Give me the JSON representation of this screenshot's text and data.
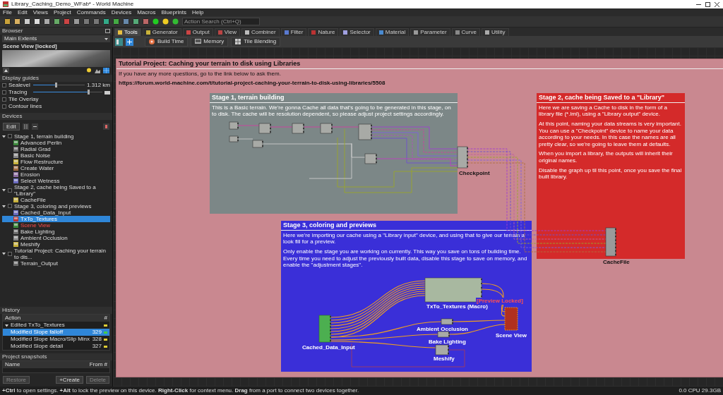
{
  "window": {
    "title": "Library_Caching_Demo_WFab* - World Machine"
  },
  "menu": [
    "File",
    "Edit",
    "Views",
    "Project",
    "Commands",
    "Devices",
    "Macros",
    "Blueprints",
    "Help"
  ],
  "action_search": {
    "placeholder": "Action Search (Ctrl+Q)"
  },
  "browser": {
    "title": "Browser",
    "view": "Main Extents",
    "preview_title": "Scene View [locked]"
  },
  "display_guides": {
    "title": "Display guides",
    "rows": [
      {
        "kind": "slider",
        "label": "Sealevel",
        "checked": false,
        "level": 0.45,
        "reading": "1.312 km"
      },
      {
        "kind": "slider",
        "label": "Tracing",
        "checked": false,
        "level": 0.8
      },
      {
        "kind": "check",
        "label": "Tile Overlay",
        "checked": false
      },
      {
        "kind": "check",
        "label": "Contour lines",
        "checked": false
      }
    ]
  },
  "devices": {
    "title": "Devices",
    "edit_button": "Edit",
    "tree": [
      {
        "label": "Stage 1, terrain building",
        "checked": false,
        "expanded": true,
        "children": [
          {
            "label": "Advanced Perlin",
            "selected": false,
            "preview": false
          },
          {
            "label": "Radial Grad",
            "selected": false,
            "preview": false
          },
          {
            "label": "Basic Noise",
            "selected": false,
            "preview": false
          },
          {
            "label": "Flow Restructure",
            "selected": false,
            "preview": false
          },
          {
            "label": "Create Water",
            "selected": false,
            "preview": false
          },
          {
            "label": "Erosion",
            "selected": false,
            "preview": false
          },
          {
            "label": "Select Wetness",
            "selected": false,
            "preview": false
          }
        ]
      },
      {
        "label": "Stage 2, cache being Saved to a \"Library\"",
        "checked": false,
        "expanded": true,
        "children": [
          {
            "label": "CacheFile",
            "selected": false,
            "preview": false
          }
        ]
      },
      {
        "label": "Stage 3, coloring and previews",
        "checked": false,
        "expanded": true,
        "children": [
          {
            "label": "Cached_Data_Input",
            "selected": false,
            "preview": false
          },
          {
            "label": "TxTo_Textures",
            "selected": true,
            "preview": false
          },
          {
            "label": "Scene View",
            "selected": false,
            "preview": true
          },
          {
            "label": "Bake Lighting",
            "selected": false,
            "preview": false
          },
          {
            "label": "Ambient Occlusion",
            "selected": false,
            "preview": false
          },
          {
            "label": "Meshify",
            "selected": false,
            "preview": false
          }
        ]
      },
      {
        "label": "Tutorial Project: Caching your terrain to dis...",
        "checked": false,
        "expanded": true,
        "children": [
          {
            "label": "Terrain_Output",
            "selected": false,
            "preview": false
          }
        ]
      }
    ]
  },
  "history": {
    "title": "History",
    "columns": [
      "Action",
      "#"
    ],
    "rows": [
      {
        "kind": "group",
        "action": "Edited TxTo_Textures",
        "expanded": true,
        "selected": false
      },
      {
        "kind": "entry",
        "action": "Modified Slope falloff",
        "number": "329",
        "selected": true
      },
      {
        "kind": "entry",
        "action": "Modified Slope Macro/Slip Minx",
        "number": "328",
        "selected": false
      },
      {
        "kind": "entry",
        "action": "Modified Slope detail",
        "number": "327",
        "selected": false
      }
    ]
  },
  "snapshots": {
    "title": "Project snapshots",
    "columns": [
      "Name",
      "From #"
    ],
    "buttons": [
      {
        "label": "Restore",
        "disabled": true
      },
      {
        "label": "+Create",
        "disabled": false
      },
      {
        "label": "Delete",
        "disabled": true
      }
    ]
  },
  "tabs": [
    {
      "label": "Tools",
      "selected": true
    },
    {
      "label": "Generator",
      "selected": false
    },
    {
      "label": "Output",
      "selected": false
    },
    {
      "label": "View",
      "selected": false
    },
    {
      "label": "Combiner",
      "selected": false
    },
    {
      "label": "Filter",
      "selected": false
    },
    {
      "label": "Nature",
      "selected": false
    },
    {
      "label": "Selector",
      "selected": false
    },
    {
      "label": "Material",
      "selected": false
    },
    {
      "label": "Parameter",
      "selected": false
    },
    {
      "label": "Curve",
      "selected": false
    },
    {
      "label": "Utility",
      "selected": false
    }
  ],
  "tools": [
    "Build Time",
    "Memory",
    "Tile Blending"
  ],
  "canvas": {
    "tutorial": {
      "title": "Tutorial Project: Caching your terrain to disk using Libraries",
      "paragraphs": [
        "If you have any more questions, go to the link below to ask them."
      ],
      "link": "https://forum.world-machine.com/t/tutorial-project-caching-your-terrain-to-disk-using-libraries/5508"
    },
    "stages": [
      {
        "title": "Stage 1, terrain building",
        "paragraphs": [
          "This is a Basic terrain. We're gonna Cache all data that's going to be generated in this stage, on to disk. The cache will be resolution dependent, so please adjust project settings accordingly."
        ]
      },
      {
        "title": "Stage 2, cache being Saved to a \"Library\"",
        "paragraphs": [
          "Here we are saving a Cache to disk in the form of a library file (*.lml), using a \"Library output\" device.",
          "At this point, naming your data streams is very important. You can use a \"Checkpoint\" device to name your data according to your needs. In this case the names are all pretty clear, so we're going to leave them at defaults.",
          "When you import a library, the outputs will inherit their original names.",
          "Disable the graph up til this point, once you save the final built library."
        ]
      },
      {
        "title": "Stage 3, coloring and previews",
        "paragraphs": [
          "Here we're importing our cache using a \"Library input\" device, and using that to give our terrain a look fill for a preview.",
          "Only enable the stage you are working on currently. This way you save on tons of building time. Every time you need to adjust the previously built data, disable this stage to save on memory, and enable the \"adjustment stages\"."
        ]
      }
    ],
    "node_labels": [
      "Checkpoint",
      "CacheFile",
      "TxTo_Textures (Macro)",
      "Ambient Occlusion",
      "Bake Lighting",
      "Meshify",
      "Cached_Data_Input",
      "Scene View"
    ],
    "preview_badge": "[Preview Locked]"
  },
  "status_bar": {
    "hint": "**+Ctrl** to open settings. **+Alt** to lock the preview on this device. **Right-Click** for context menu. **Drag** from a port to connect two devices together.",
    "stats": "0.0 CPU 29.3GB"
  }
}
